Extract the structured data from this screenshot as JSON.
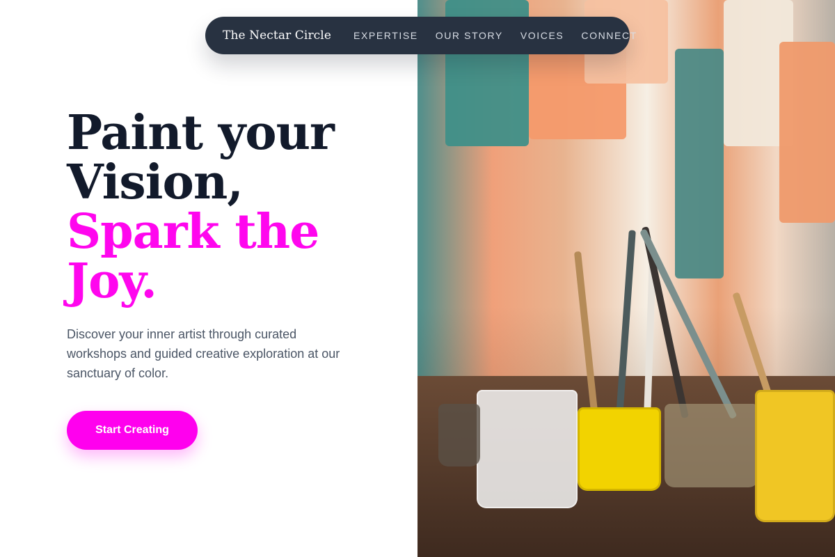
{
  "nav": {
    "brand": "The Nectar Circle",
    "links": [
      {
        "label": "EXPERTISE"
      },
      {
        "label": "OUR STORY"
      },
      {
        "label": "VOICES"
      },
      {
        "label": "CONNECT"
      }
    ]
  },
  "hero": {
    "title_lines": [
      "Paint your",
      "Vision,"
    ],
    "accent_lines": [
      "Spark the",
      "Joy."
    ],
    "subtitle": "Discover your inner artist through curated workshops and guided creative exploration at our sanctuary of color.",
    "cta_label": "Start Creating"
  },
  "colors": {
    "accent": "#ff00ee",
    "title": "#121a2b",
    "nav_bg": "#283241"
  },
  "image": {
    "subject": "art-studio-paint-brushes-jars"
  }
}
